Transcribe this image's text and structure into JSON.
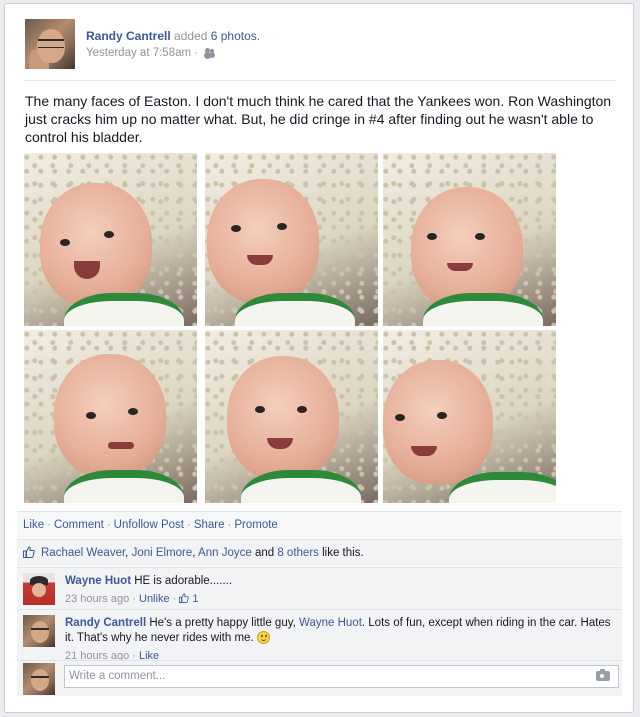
{
  "post": {
    "author": "Randy Cantrell",
    "action_text": "added",
    "photos_link": "6 photos.",
    "timestamp": "Yesterday at 7:58am",
    "separator": "·",
    "text": "The many faces of Easton. I don't much think he cared that the Yankees won. Ron Washington just cracks him up no matter what. But, he did cringe in #4 after finding out he wasn't able to control his bladder.",
    "photo_count": 6
  },
  "actions": {
    "like": "Like",
    "comment": "Comment",
    "unfollow": "Unfollow Post",
    "share": "Share",
    "promote": "Promote"
  },
  "likes": {
    "names": [
      "Rachael Weaver",
      "Joni Elmore",
      "Ann Joyce"
    ],
    "and_text": "and",
    "others": "8 others",
    "suffix": "like this."
  },
  "comments": [
    {
      "name": "Wayne Huot",
      "text": "HE is adorable.......",
      "time": "23 hours ago",
      "action": "Unlike",
      "like_count": "1"
    },
    {
      "name": "Randy Cantrell",
      "text_before": "He's a pretty happy little guy,",
      "mention": "Wayne Huot",
      "text_after": ". Lots of fun, except when riding in the car. Hates it. That's why he never rides with me.",
      "time": "21 hours ago",
      "action": "Like"
    }
  ],
  "composer": {
    "placeholder": "Write a comment..."
  },
  "icons": {
    "audience": "friends-icon",
    "like": "thumbs-up-icon",
    "camera": "camera-icon",
    "emoji": "smiley-icon"
  },
  "colors": {
    "link": "#3b5998",
    "meta": "#90949c",
    "panel": "#f2f3f5"
  }
}
